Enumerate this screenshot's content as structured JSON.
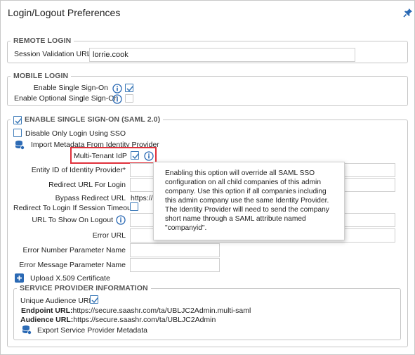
{
  "page": {
    "title": "Login/Logout Preferences"
  },
  "remote_login": {
    "legend": "REMOTE LOGIN",
    "session_validation_label": "Session Validation URL",
    "session_validation_value": "lorrie.cook"
  },
  "mobile_login": {
    "legend": "MOBILE LOGIN",
    "enable_sso_label": "Enable Single Sign-On",
    "enable_optional_sso_label": "Enable Optional Single Sign-On"
  },
  "saml": {
    "legend": "ENABLE SINGLE SIGN-ON (SAML 2.0)",
    "disable_only_login_label": "Disable Only Login Using SSO",
    "import_metadata_label": "Import Metadata From Identity Provider",
    "multi_tenant_label": "Multi-Tenant IdP",
    "entity_id_label": "Entity ID of Identity Provider*",
    "redirect_url_label": "Redirect URL For Login",
    "bypass_redirect_label": "Bypass Redirect URL",
    "bypass_redirect_value": "https://",
    "redirect_timeout_label": "Redirect To Login If Session Timeout",
    "url_on_logout_label": "URL To Show On Logout",
    "error_url_label": "Error URL",
    "error_number_param_label": "Error Number Parameter Name",
    "error_message_param_label": "Error Message Parameter Name",
    "upload_cert_label": "Upload X.509 Certificate"
  },
  "tooltip": {
    "text": "Enabling this option will override all SAML SSO configuration on all child companies of this admin company. Use this option if all companies including this admin company use the same Identity Provider. The Identity Provider will need to send the company short name through a SAML attribute named \"companyid\"."
  },
  "service_provider": {
    "legend": "SERVICE PROVIDER INFORMATION",
    "unique_audience_label": "Unique Audience URL",
    "endpoint_label": "Endpoint URL:",
    "endpoint_value": "https://secure.saashr.com/ta/UBLJC2Admin.multi-saml",
    "audience_label": "Audience URL:",
    "audience_value": "https://secure.saashr.com/ta/UBLJC2Admin",
    "export_label": "Export Service Provider Metadata"
  },
  "colors": {
    "accent": "#2a69b4",
    "checkbox_border": "#3d7ab8",
    "highlight": "#e0303a"
  }
}
